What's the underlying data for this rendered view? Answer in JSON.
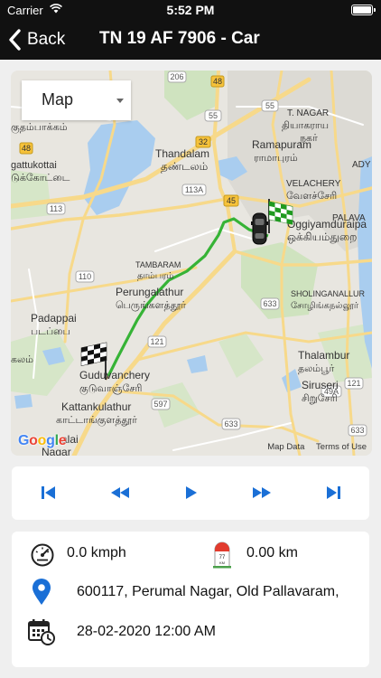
{
  "status_bar": {
    "carrier": "Carrier",
    "time": "5:52 PM"
  },
  "nav": {
    "back_label": "Back",
    "title": "TN 19 AF 7906 - Car"
  },
  "map": {
    "map_type": "Map",
    "footer_data": "Map Data",
    "footer_terms": "Terms of Use",
    "google_logo": "Google",
    "labels": {
      "t_nagar": "T. NAGAR",
      "t_nagar_ta": "தியாகராய",
      "t_nagar_ta2": "நகர்",
      "kuthambakkam": "குதம்பாக்கம்",
      "gattukottai": "gattukottai",
      "gattukottai_ta": "டுக்கோட்டை",
      "thandalam": "Thandalam",
      "thandalam_ta": "தண்டலம்",
      "ramapuram": "Ramapuram",
      "ramapuram_ta": "ராமாபுரம்",
      "ady": "ADY",
      "velachery": "VELACHERY",
      "velachery_ta": "வேளச்சேரி",
      "palava": "PALAVA",
      "oggiyam": "Oggiyamduraipa",
      "oggiyam_ta": "ஒக்கியம்துறை",
      "tambaram": "TAMBARAM",
      "tambaram_ta": "தாம்பரம்",
      "perungalathur": "Perungalathur",
      "perungalathur_ta": "பெருங்களத்தூர்",
      "sholinganallur": "SHOLINGANALLUR",
      "sholinganallur_ta": "சோழிங்கநல்லூர்",
      "padappai": "Padappai",
      "padappai_ta": "படப்பை",
      "kalam_ta": "கலம்",
      "guduvanchery": "Guduvanchery",
      "guduvanchery_ta": "குடுவாஞ்சேரி",
      "thalambur": "Thalambur",
      "thalambur_ta": "தலம்பூர்",
      "kattankulathur": "Kattankulathur",
      "kattankulathur_ta": "காட்டாங்குளத்தூர்",
      "siruseri": "Siruseri",
      "siruseri_ta": "சிறுசேரி",
      "malai": "alai",
      "nagar": "Nagar"
    },
    "route_shields": [
      "206",
      "48",
      "55",
      "55",
      "48",
      "32",
      "113",
      "113A",
      "45",
      "110",
      "633",
      "121",
      "597",
      "633",
      "49A",
      "121",
      "633"
    ]
  },
  "controls": {
    "icons": [
      "skip-to-start-icon",
      "rewind-icon",
      "play-icon",
      "fast-forward-icon",
      "skip-to-end-icon"
    ],
    "accent": "#1a6fd6"
  },
  "info": {
    "speed": "0.0 kmph",
    "distance": "0.00 km",
    "address": "600117, Perumal Nagar, Old Pallavaram,",
    "datetime": "28-02-2020 12:00 AM",
    "milestone_number": "77",
    "milestone_unit": "KM"
  }
}
